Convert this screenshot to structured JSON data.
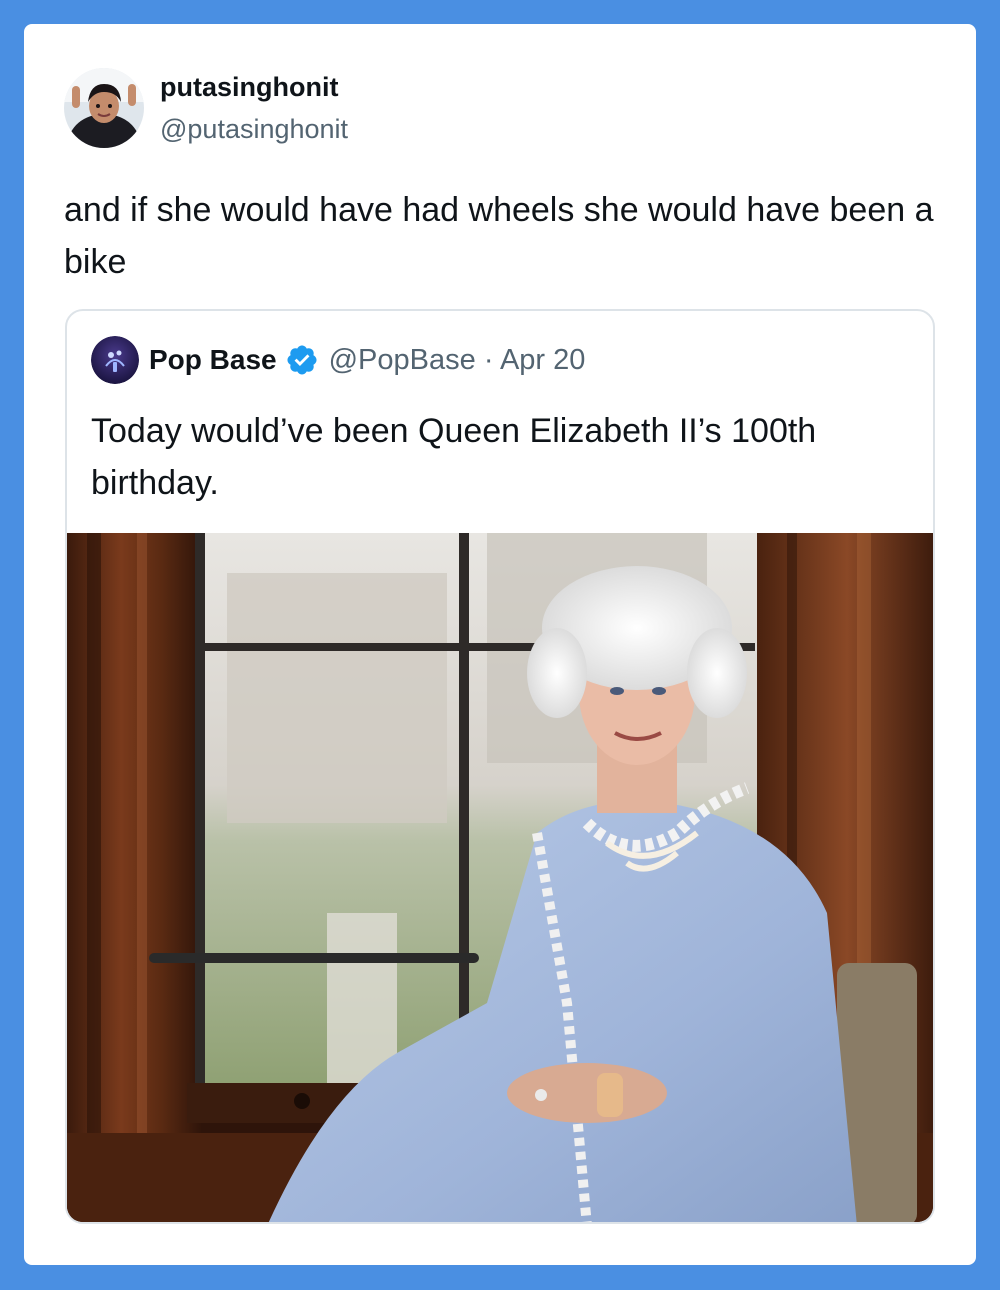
{
  "tweet": {
    "display_name": "putasinghonit",
    "handle": "@putasinghonit",
    "text": "and if she would have had wheels she would have been a bike",
    "avatar_icon": "user-avatar-icon"
  },
  "quoted_tweet": {
    "display_name": "Pop Base",
    "handle": "@PopBase",
    "separator": "·",
    "date": "Apr 20",
    "text": "Today would’ve been Queen Elizabeth II’s 100th birthday.",
    "verified": true,
    "verified_color": "#1d9bf0",
    "avatar_icon": "pop-base-logo-icon",
    "image_icon": "queen-portrait-image"
  },
  "colors": {
    "background": "#4a8fe2",
    "card": "#ffffff",
    "text_primary": "#0f1419",
    "text_secondary": "#536471",
    "border": "#dde3e8"
  }
}
